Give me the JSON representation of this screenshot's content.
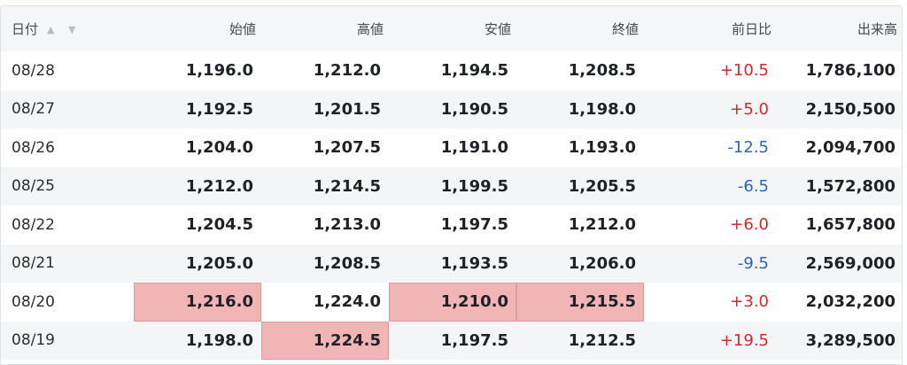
{
  "table": {
    "headers": {
      "date": "日付",
      "open": "始値",
      "high": "高値",
      "low": "安値",
      "close": "終値",
      "change": "前日比",
      "volume": "出来高"
    },
    "sort_icons": "▲ ▼",
    "highlight_color": "#f2b5b5",
    "positive_color": "#d9262b",
    "negative_color": "#2f62c7",
    "rows": [
      {
        "date": "08/28",
        "open": "1,196.0",
        "high": "1,212.0",
        "low": "1,194.5",
        "close": "1,208.5",
        "change": "+10.5",
        "volume": "1,786,100"
      },
      {
        "date": "08/27",
        "open": "1,192.5",
        "high": "1,201.5",
        "low": "1,190.5",
        "close": "1,198.0",
        "change": "+5.0",
        "volume": "2,150,500"
      },
      {
        "date": "08/26",
        "open": "1,204.0",
        "high": "1,207.5",
        "low": "1,191.0",
        "close": "1,193.0",
        "change": "-12.5",
        "volume": "2,094,700"
      },
      {
        "date": "08/25",
        "open": "1,212.0",
        "high": "1,214.5",
        "low": "1,199.5",
        "close": "1,205.5",
        "change": "-6.5",
        "volume": "1,572,800"
      },
      {
        "date": "08/22",
        "open": "1,204.5",
        "high": "1,213.0",
        "low": "1,197.5",
        "close": "1,212.0",
        "change": "+6.0",
        "volume": "1,657,800"
      },
      {
        "date": "08/21",
        "open": "1,205.0",
        "high": "1,208.5",
        "low": "1,193.5",
        "close": "1,206.0",
        "change": "-9.5",
        "volume": "2,569,000"
      },
      {
        "date": "08/20",
        "open": "1,216.0",
        "high": "1,224.0",
        "low": "1,210.0",
        "close": "1,215.5",
        "change": "+3.0",
        "volume": "2,032,200"
      },
      {
        "date": "08/19",
        "open": "1,198.0",
        "high": "1,224.5",
        "low": "1,197.5",
        "close": "1,212.5",
        "change": "+19.5",
        "volume": "3,289,500"
      }
    ],
    "highlighted_cells": [
      {
        "row": 6,
        "col": "open"
      },
      {
        "row": 6,
        "col": "low"
      },
      {
        "row": 6,
        "col": "close"
      },
      {
        "row": 7,
        "col": "high"
      }
    ]
  }
}
